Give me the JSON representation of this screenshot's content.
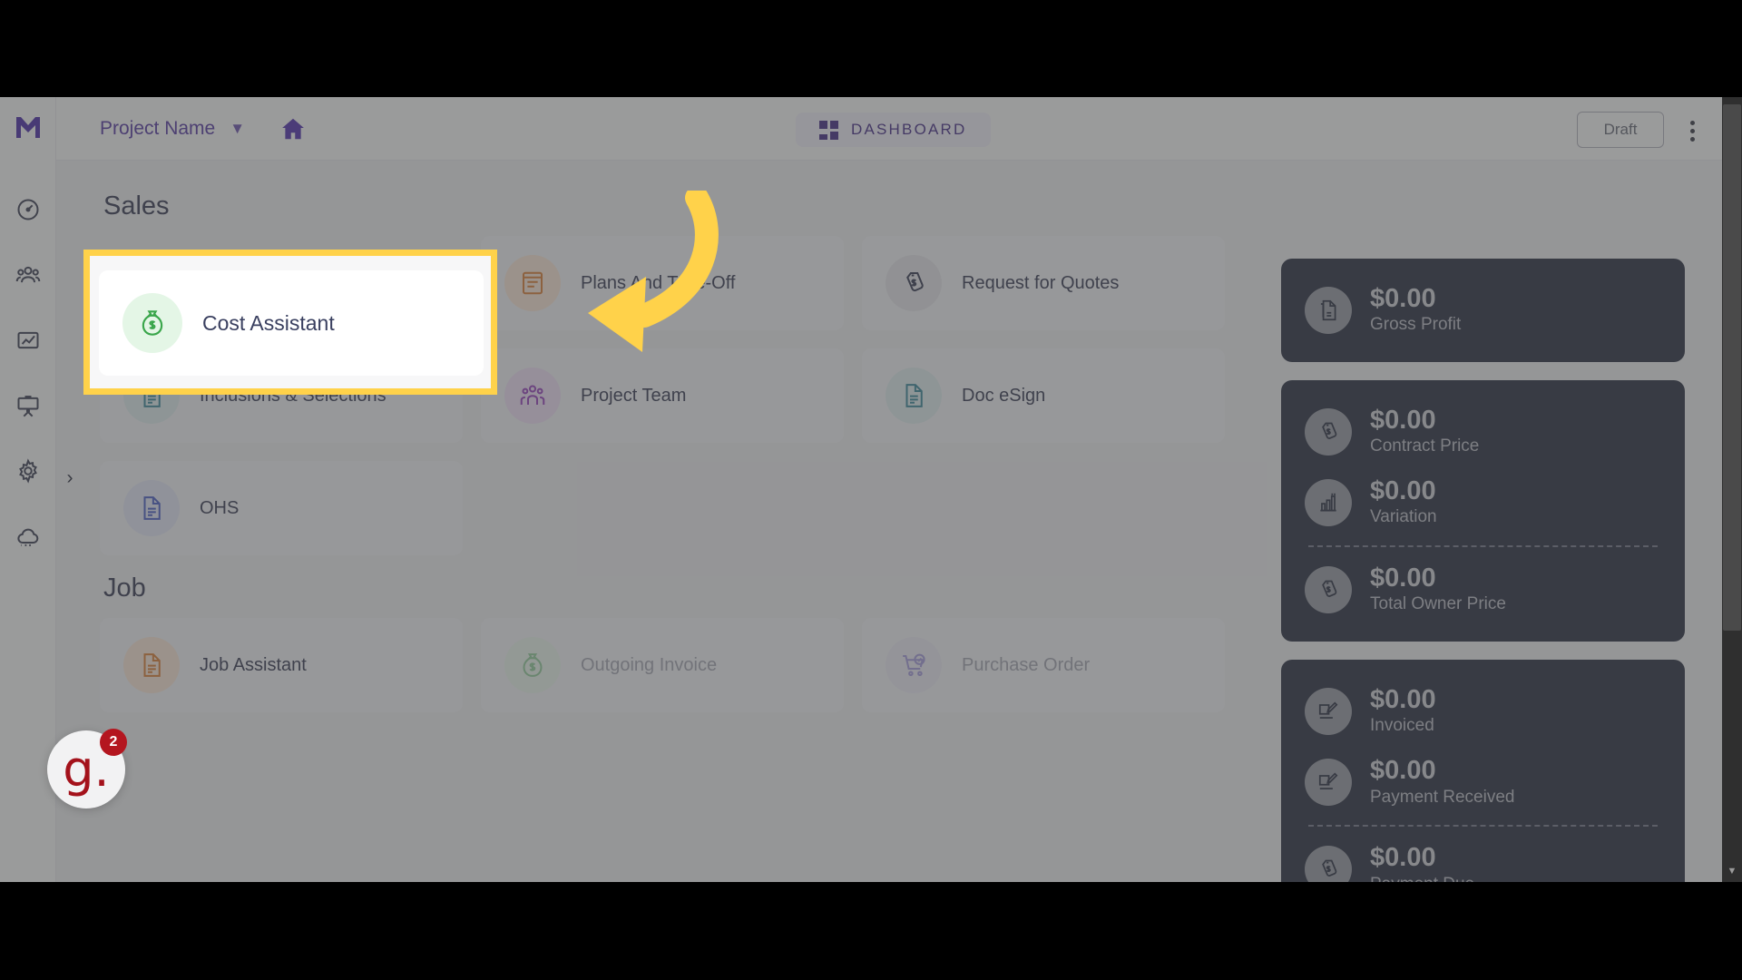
{
  "header": {
    "project_name": "Project Name",
    "dropdown_icon": "chevron-down-icon",
    "home_icon": "home-icon",
    "dashboard_label": "DASHBOARD",
    "dashboard_icon": "grid-icon",
    "draft_label": "Draft",
    "more_icon": "kebab-menu-icon"
  },
  "sidebar": {
    "logo": "app-logo",
    "items": [
      {
        "icon": "dashboard-gauge-icon"
      },
      {
        "icon": "people-group-icon"
      },
      {
        "icon": "analytics-chart-icon"
      },
      {
        "icon": "presentation-board-icon"
      },
      {
        "icon": "settings-gear-icon"
      },
      {
        "icon": "cloud-icon"
      }
    ],
    "expand_label": "›"
  },
  "main": {
    "sections": [
      {
        "title": "Sales",
        "cards": [
          {
            "label": "Cost Assistant",
            "icon": "money-bag-icon",
            "color": "green",
            "disabled": false,
            "highlighted": true
          },
          {
            "label": "Plans And Take-Off",
            "icon": "plans-icon",
            "color": "orange",
            "disabled": false,
            "highlighted": false
          },
          {
            "label": "Request for Quotes",
            "icon": "price-tag-icon",
            "color": "slate",
            "disabled": false,
            "highlighted": false
          },
          {
            "label": "Inclusions & Selections",
            "icon": "document-icon",
            "color": "teal",
            "disabled": false,
            "highlighted": false
          },
          {
            "label": "Project Team",
            "icon": "people-icon",
            "color": "purple",
            "disabled": false,
            "highlighted": false
          },
          {
            "label": "Doc eSign",
            "icon": "document-icon",
            "color": "teal",
            "disabled": false,
            "highlighted": false
          },
          {
            "label": "OHS",
            "icon": "document-icon",
            "color": "blue",
            "disabled": false,
            "highlighted": false
          }
        ]
      },
      {
        "title": "Job",
        "cards": [
          {
            "label": "Job Assistant",
            "icon": "document-icon",
            "color": "orange",
            "disabled": false,
            "highlighted": false
          },
          {
            "label": "Outgoing Invoice",
            "icon": "money-bag-icon",
            "color": "green",
            "disabled": true,
            "highlighted": false
          },
          {
            "label": "Purchase Order",
            "icon": "shopping-cart-icon",
            "color": "indigo",
            "disabled": true,
            "highlighted": false
          }
        ]
      }
    ]
  },
  "stats": {
    "panels": [
      {
        "items": [
          {
            "value": "$0.00",
            "label": "Gross Profit",
            "icon": "document-dollar-icon",
            "divider_after": false
          }
        ]
      },
      {
        "items": [
          {
            "value": "$0.00",
            "label": "Contract Price",
            "icon": "price-tag-icon",
            "divider_after": false
          },
          {
            "value": "$0.00",
            "label": "Variation",
            "icon": "bar-chart-icon",
            "divider_after": true
          },
          {
            "value": "$0.00",
            "label": "Total Owner Price",
            "icon": "price-tag-icon",
            "divider_after": false
          }
        ]
      },
      {
        "items": [
          {
            "value": "$0.00",
            "label": "Invoiced",
            "icon": "sign-document-icon",
            "divider_after": false
          },
          {
            "value": "$0.00",
            "label": "Payment Received",
            "icon": "sign-document-icon",
            "divider_after": true
          },
          {
            "value": "$0.00",
            "label": "Payment Due",
            "icon": "price-tag-icon",
            "divider_after": false
          }
        ]
      }
    ]
  },
  "widget": {
    "logo_text": "g.",
    "badge_count": "2"
  },
  "colors": {
    "highlight": "#ffd24a",
    "brand_purple": "#38217e",
    "panel_dark": "#1c2335",
    "badge_red": "#b4161f"
  }
}
